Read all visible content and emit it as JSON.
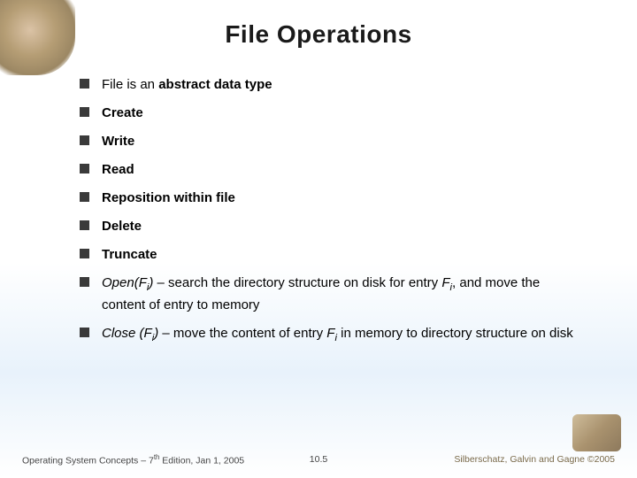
{
  "title": "File Operations",
  "bullets": {
    "b0_pre": "File is an ",
    "b0_bold": "abstract data type",
    "b1": "Create",
    "b2": "Write",
    "b3": "Read",
    "b4": "Reposition within file",
    "b5": "Delete",
    "b6": "Truncate",
    "b7_open": "Open(F",
    "b7_sub": "i",
    "b7_mid": ")",
    "b7_text1": " – search the directory structure on disk for entry ",
    "b7_fi": "F",
    "b7_text2": ", and move the content of entry to memory",
    "b8_close": "Close (F",
    "b8_sub": "i",
    "b8_mid": ")",
    "b8_text1": " – move the content of entry ",
    "b8_fi": "F",
    "b8_text2": " in memory to directory structure on disk"
  },
  "footer": {
    "left_pre": "Operating System Concepts – 7",
    "left_sup": "th",
    "left_post": " Edition, Jan 1, 2005",
    "center": "10.5",
    "right": "Silberschatz, Galvin and Gagne ©2005"
  }
}
